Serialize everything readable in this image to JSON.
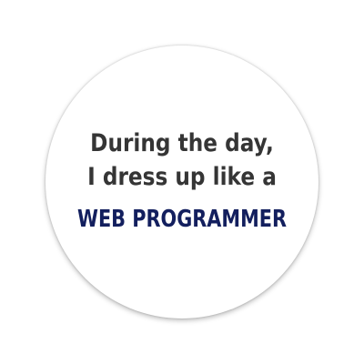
{
  "sticker": {
    "line1": "During the day,",
    "line2": "I dress up like a",
    "line3": "WEB PROGRAMMER"
  },
  "colors": {
    "background": "#ffffff",
    "dark_text": "#353535",
    "accent_text": "#131f5e"
  }
}
